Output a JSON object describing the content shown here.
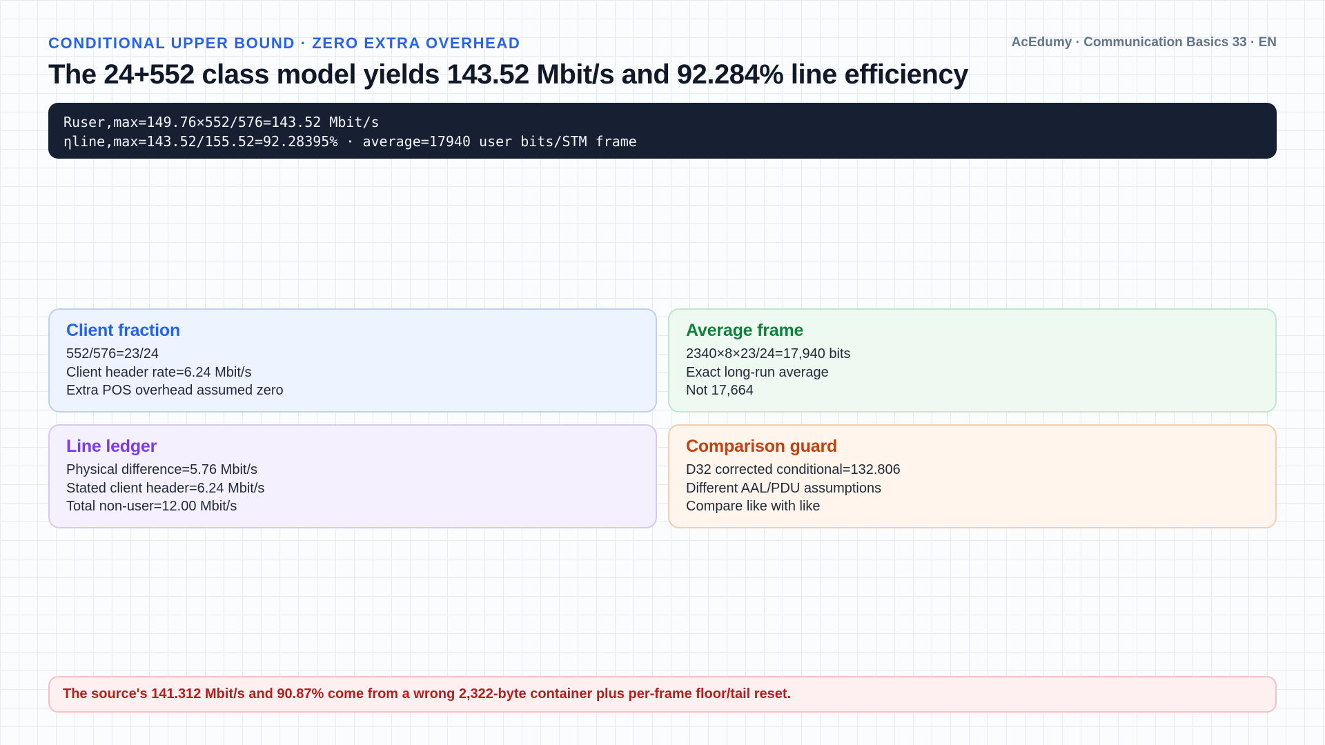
{
  "header": {
    "kicker": "CONDITIONAL UPPER BOUND · ZERO EXTRA OVERHEAD",
    "brand": "AcEdumy · Communication Basics 33 · EN",
    "title": "The 24+552 class model yields 143.52 Mbit/s and 92.284% line efficiency"
  },
  "formula": {
    "line1": "Ruser,max=149.76×552/576=143.52 Mbit/s",
    "line2": "ηline,max=143.52/155.52=92.28395% · average=17940 user bits/STM frame"
  },
  "cards": [
    {
      "title": "Client fraction",
      "lines": [
        "552/576=23/24",
        "Client header rate=6.24 Mbit/s",
        "Extra POS overhead assumed zero"
      ]
    },
    {
      "title": "Average frame",
      "lines": [
        "2340×8×23/24=17,940 bits",
        "Exact long-run average",
        "Not 17,664"
      ]
    },
    {
      "title": "Line ledger",
      "lines": [
        "Physical difference=5.76 Mbit/s",
        "Stated client header=6.24 Mbit/s",
        "Total non-user=12.00 Mbit/s"
      ]
    },
    {
      "title": "Comparison guard",
      "lines": [
        "D32 corrected conditional=132.806",
        "Different AAL/PDU assumptions",
        "Compare like with like"
      ]
    }
  ],
  "warning": "The source's 141.312 Mbit/s and 90.87% come from a wrong 2,322-byte container plus per-frame floor/tail reset.",
  "colors": {
    "accent_blue": "#2563eb",
    "accent_green": "#15803d",
    "accent_purple": "#7c3aed",
    "accent_orange": "#c2410c",
    "warning_red": "#b91c1c",
    "formula_bg": "#172033"
  }
}
